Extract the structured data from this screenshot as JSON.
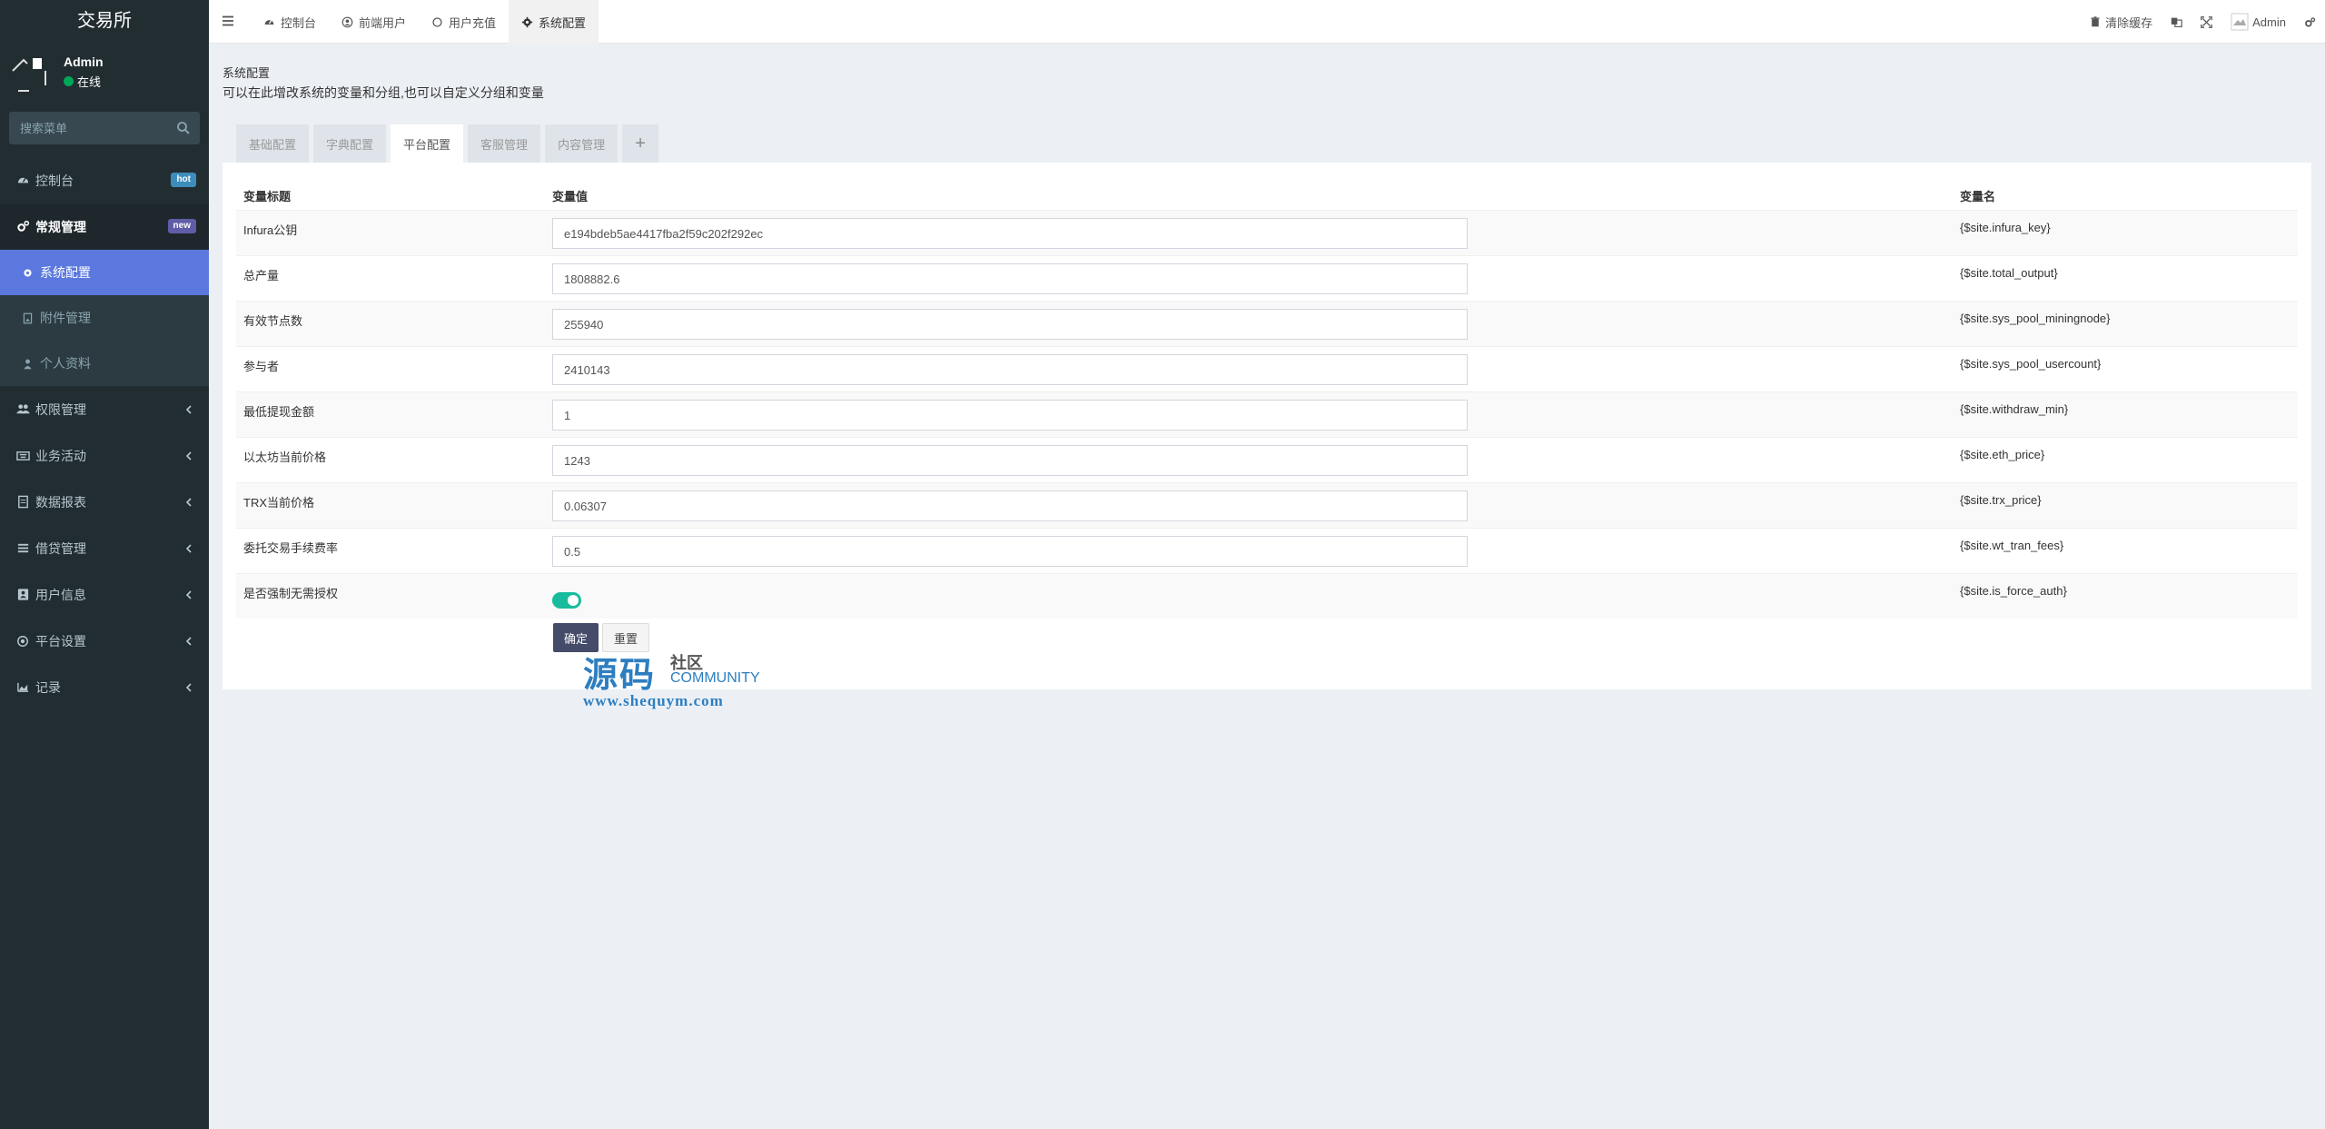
{
  "brand": "交易所",
  "user": {
    "name": "Admin",
    "status": "在线"
  },
  "search": {
    "placeholder": "搜索菜单"
  },
  "menu": {
    "dashboard": {
      "label": "控制台",
      "badge": "hot"
    },
    "general": {
      "label": "常规管理",
      "badge": "new"
    },
    "sub": [
      {
        "label": "系统配置"
      },
      {
        "label": "附件管理"
      },
      {
        "label": "个人资料"
      }
    ],
    "items": [
      {
        "label": "权限管理"
      },
      {
        "label": "业务活动"
      },
      {
        "label": "数据报表"
      },
      {
        "label": "借贷管理"
      },
      {
        "label": "用户信息"
      },
      {
        "label": "平台设置"
      },
      {
        "label": "记录"
      }
    ]
  },
  "topnav": {
    "tabs": [
      {
        "label": "控制台"
      },
      {
        "label": "前端用户"
      },
      {
        "label": "用户充值"
      },
      {
        "label": "系统配置"
      }
    ],
    "clear_cache": "清除缓存",
    "admin": "Admin"
  },
  "page": {
    "title": "系统配置",
    "description": "可以在此增改系统的变量和分组,也可以自定义分组和变量"
  },
  "config_tabs": [
    {
      "label": "基础配置"
    },
    {
      "label": "字典配置"
    },
    {
      "label": "平台配置"
    },
    {
      "label": "客服管理"
    },
    {
      "label": "内容管理"
    },
    {
      "label": "+"
    }
  ],
  "table": {
    "headers": {
      "title": "变量标题",
      "value": "变量值",
      "name": "变量名"
    },
    "rows": [
      {
        "title": "Infura公钥",
        "value": "e194bdeb5ae4417fba2f59c202f292ec",
        "name": "{$site.infura_key}"
      },
      {
        "title": "总产量",
        "value": "1808882.6",
        "name": "{$site.total_output}"
      },
      {
        "title": "有效节点数",
        "value": "255940",
        "name": "{$site.sys_pool_miningnode}"
      },
      {
        "title": "参与者",
        "value": "2410143",
        "name": "{$site.sys_pool_usercount}"
      },
      {
        "title": "最低提现金额",
        "value": "1",
        "name": "{$site.withdraw_min}"
      },
      {
        "title": "以太坊当前价格",
        "value": "1243",
        "name": "{$site.eth_price}"
      },
      {
        "title": "TRX当前价格",
        "value": "0.06307",
        "name": "{$site.trx_price}"
      },
      {
        "title": "委托交易手续费率",
        "value": "0.5",
        "name": "{$site.wt_tran_fees}"
      },
      {
        "title": "是否强制无需授权",
        "value": "on",
        "name": "{$site.is_force_auth}"
      }
    ]
  },
  "buttons": {
    "ok": "确定",
    "reset": "重置"
  },
  "watermark": {
    "big": "源码",
    "small": "社区",
    "community": "COMMUNITY",
    "url": "www.shequym.com"
  },
  "colors": {
    "sidebar": "#222d32",
    "active_menu": "#5b78de",
    "toggle_on": "#18bc9c",
    "primary_btn": "#444c69"
  }
}
